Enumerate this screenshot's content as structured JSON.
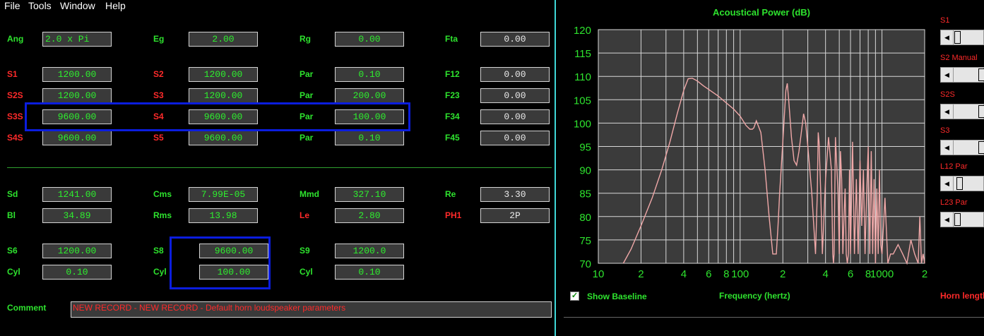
{
  "menu": {
    "file": "File",
    "tools": "Tools",
    "window": "Window",
    "help": "Help"
  },
  "rows": [
    {
      "a": {
        "l": "Ang",
        "lc": "g",
        "v": "2.0 x Pi",
        "vc": "gt",
        "al": "left"
      },
      "b": {
        "l": "Eg",
        "lc": "g",
        "v": "2.00",
        "vc": "gt"
      },
      "c": {
        "l": "Rg",
        "lc": "g",
        "v": "0.00",
        "vc": "gt"
      },
      "d": {
        "l": "Fta",
        "lc": "g",
        "v": "0.00",
        "vc": "wt"
      }
    },
    {
      "a": {
        "l": "S1",
        "lc": "r",
        "v": "1200.00",
        "vc": "gt"
      },
      "b": {
        "l": "S2",
        "lc": "r",
        "v": "1200.00",
        "vc": "gt"
      },
      "c": {
        "l": "Par",
        "lc": "g",
        "v": "0.10",
        "vc": "gt"
      },
      "d": {
        "l": "F12",
        "lc": "g",
        "v": "0.00",
        "vc": "wt"
      }
    },
    {
      "a": {
        "l": "S2S",
        "lc": "r",
        "v": "1200.00",
        "vc": "gt"
      },
      "b": {
        "l": "S3",
        "lc": "r",
        "v": "1200.00",
        "vc": "gt"
      },
      "c": {
        "l": "Par",
        "lc": "g",
        "v": "200.00",
        "vc": "gt"
      },
      "d": {
        "l": "F23",
        "lc": "g",
        "v": "0.00",
        "vc": "wt"
      }
    },
    {
      "a": {
        "l": "S3S",
        "lc": "r",
        "v": "9600.00",
        "vc": "gt"
      },
      "b": {
        "l": "S4",
        "lc": "r",
        "v": "9600.00",
        "vc": "gt"
      },
      "c": {
        "l": "Par",
        "lc": "g",
        "v": "100.00",
        "vc": "gt"
      },
      "d": {
        "l": "F34",
        "lc": "g",
        "v": "0.00",
        "vc": "wt"
      }
    },
    {
      "a": {
        "l": "S4S",
        "lc": "r",
        "v": "9600.00",
        "vc": "gt"
      },
      "b": {
        "l": "S5",
        "lc": "r",
        "v": "9600.00",
        "vc": "gt"
      },
      "c": {
        "l": "Par",
        "lc": "g",
        "v": "0.10",
        "vc": "gt"
      },
      "d": {
        "l": "F45",
        "lc": "g",
        "v": "0.00",
        "vc": "wt"
      }
    },
    {
      "a": {
        "l": "Sd",
        "lc": "g",
        "v": "1241.00",
        "vc": "gt"
      },
      "b": {
        "l": "Cms",
        "lc": "g",
        "v": "7.99E-05",
        "vc": "gt"
      },
      "c": {
        "l": "Mmd",
        "lc": "g",
        "v": "327.10",
        "vc": "gt"
      },
      "d": {
        "l": "Re",
        "lc": "g",
        "v": "3.30",
        "vc": "wt"
      }
    },
    {
      "a": {
        "l": "Bl",
        "lc": "g",
        "v": "34.89",
        "vc": "gt"
      },
      "b": {
        "l": "Rms",
        "lc": "g",
        "v": "13.98",
        "vc": "gt"
      },
      "c": {
        "l": "Le",
        "lc": "r",
        "v": "2.80",
        "vc": "gt"
      },
      "d": {
        "l": "PH1",
        "lc": "r",
        "v": "2P",
        "vc": "wt"
      }
    },
    {
      "a": {
        "l": "S6",
        "lc": "g",
        "v": "1200.00",
        "vc": "gt"
      },
      "b": {
        "l": "S8",
        "lc": "g",
        "v": "9600.00",
        "vc": "gt"
      },
      "c": {
        "l": "S9",
        "lc": "g",
        "v": "1200.0",
        "vc": "gt"
      },
      "d": null
    },
    {
      "a": {
        "l": "Cyl",
        "lc": "g",
        "v": "0.10",
        "vc": "gt"
      },
      "b": {
        "l": "Cyl",
        "lc": "g",
        "v": "100.00",
        "vc": "gt"
      },
      "c": {
        "l": "Cyl",
        "lc": "g",
        "v": "0.10",
        "vc": "gt"
      },
      "d": null
    }
  ],
  "comment": {
    "label": "Comment",
    "value": "NEW RECORD - NEW RECORD - Default horn loudspeaker parameters"
  },
  "chart_data": {
    "type": "line",
    "title": "Acoustical Power (dB)",
    "xlabel": "Frequency (hertz)",
    "ylabel": "",
    "xscale": "log",
    "xlim": [
      10,
      2000
    ],
    "ylim": [
      70,
      120
    ],
    "xtick_labels": [
      "10",
      "2",
      "4",
      "6",
      "8",
      "100",
      "2",
      "4",
      "6",
      "8",
      "1000",
      "2"
    ],
    "yticks": [
      70,
      75,
      80,
      85,
      90,
      95,
      100,
      105,
      110,
      115,
      120
    ],
    "grid": true,
    "line_color": "#f0a8a8",
    "series": [
      {
        "x": [
          15,
          17,
          20,
          24,
          28,
          32,
          36,
          40,
          43,
          46,
          50,
          55,
          60,
          70,
          80,
          90,
          100,
          110,
          117,
          122,
          125,
          130,
          140,
          150,
          160,
          170,
          180,
          185,
          190,
          200,
          210,
          215,
          220,
          230,
          240,
          250,
          260,
          270,
          280,
          290,
          300,
          320,
          340,
          350,
          355,
          360,
          370,
          380,
          400,
          420,
          440,
          450,
          455,
          460,
          470,
          490,
          500,
          510,
          520,
          530,
          540,
          550,
          560,
          570,
          580,
          590,
          600,
          620,
          640,
          660,
          680,
          700,
          720,
          740,
          760,
          780,
          800,
          820,
          840,
          860,
          880,
          900,
          920,
          940,
          960,
          980,
          1000,
          1050,
          1100,
          1150,
          1200,
          1300,
          1400,
          1500,
          1600,
          1700,
          1800,
          1850,
          1900,
          1950,
          2000
        ],
        "y": [
          70,
          73,
          78,
          84,
          90,
          96,
          102,
          107,
          109.5,
          109.6,
          109,
          108,
          107.2,
          105.8,
          104.3,
          103,
          101.5,
          99.5,
          98.7,
          98.7,
          99,
          100.5,
          98,
          90,
          80,
          72,
          72,
          78,
          85,
          96,
          107,
          108.5,
          105,
          97,
          92,
          91,
          94,
          98,
          102,
          100,
          95,
          85,
          72,
          85,
          98,
          96,
          85,
          72,
          88,
          97,
          90,
          72,
          70,
          72,
          97,
          85,
          72,
          94,
          88,
          72,
          80,
          86,
          72,
          70,
          72,
          90,
          72,
          96,
          72,
          88,
          72,
          92,
          78,
          90,
          72,
          85,
          95,
          72,
          94,
          72,
          88,
          70,
          86,
          72,
          90,
          74,
          72,
          84,
          70,
          72,
          72,
          74,
          72,
          70,
          75,
          72,
          70,
          80,
          70,
          72,
          70
        ]
      }
    ]
  },
  "right": {
    "show_baseline": "Show Baseline",
    "horn_length": "Horn length",
    "sliders": [
      {
        "label": "S1",
        "pos": 0.0
      },
      {
        "label": "S2 Manual",
        "pos": 0.85
      },
      {
        "label": "S2S",
        "pos": 0.85
      },
      {
        "label": "S3",
        "pos": 0.85
      },
      {
        "label": "L12 Par",
        "pos": 0.08
      },
      {
        "label": "L23 Par",
        "pos": 0.0
      }
    ]
  }
}
